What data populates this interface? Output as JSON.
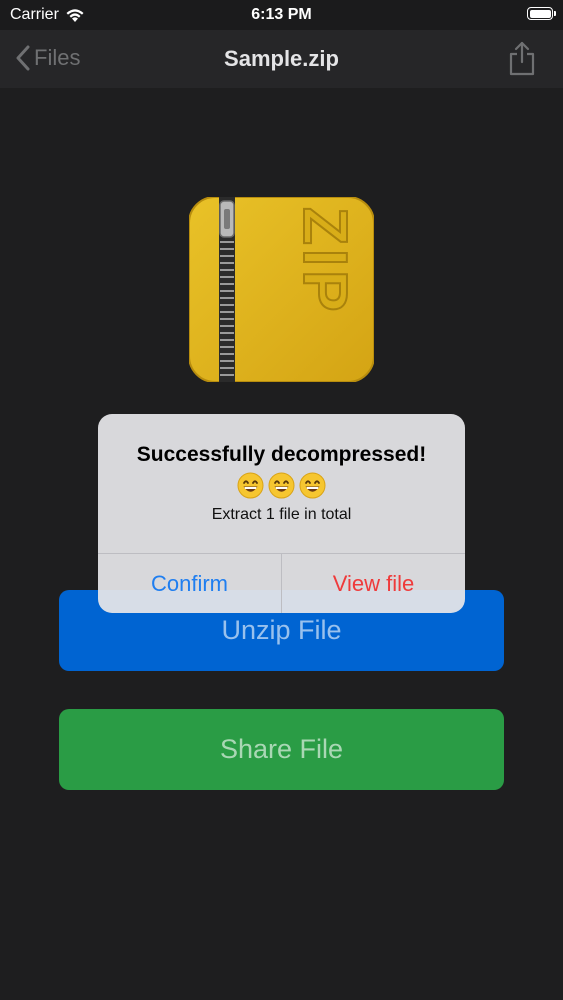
{
  "status_bar": {
    "carrier": "Carrier",
    "time": "6:13 PM"
  },
  "nav": {
    "back_label": "Files",
    "title": "Sample.zip"
  },
  "file_icon": {
    "label_text": "ZIP"
  },
  "buttons": {
    "unzip_label": "Unzip File",
    "share_label": "Share File"
  },
  "alert": {
    "title": "Successfully decompressed!",
    "emoji": "😄😄😄",
    "message": "Extract 1 file in total",
    "confirm_label": "Confirm",
    "view_label": "View file"
  },
  "colors": {
    "unzip_button": "#0064d2",
    "share_button": "#2a9c45",
    "alert_confirm": "#1f7ef0",
    "alert_view": "#ef3a3a"
  }
}
